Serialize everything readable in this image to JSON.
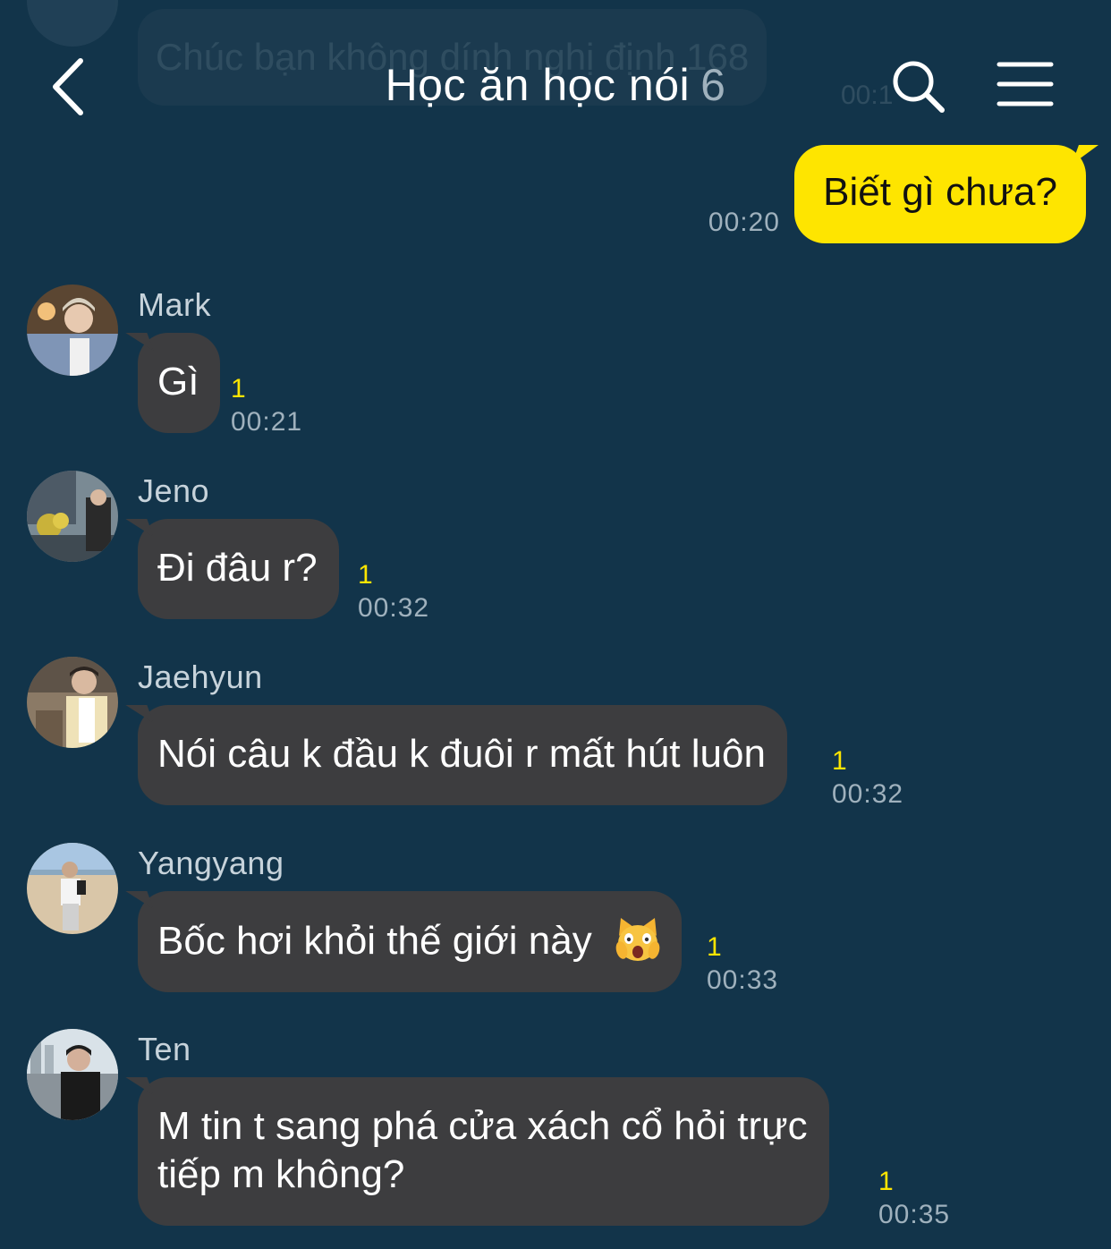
{
  "ghost_message": {
    "text": "Chúc bạn không dính nghị định 168",
    "time": "00:1"
  },
  "header": {
    "title": "Học ăn học nói",
    "member_count": "6"
  },
  "colors": {
    "background": "#12344a",
    "my_bubble": "#fee500",
    "their_bubble": "#3d3d3f",
    "unread": "#fee500"
  },
  "messages": [
    {
      "sender": "",
      "text": "Biết gì chưa?",
      "time": "00:20",
      "outgoing": true
    },
    {
      "sender": "Mark",
      "text": "Gì",
      "unread": "1",
      "time": "00:21"
    },
    {
      "sender": "Jeno",
      "text": "Đi đâu r?",
      "unread": "1",
      "time": "00:32"
    },
    {
      "sender": "Jaehyun",
      "text": "Nói câu k đầu k đuôi r mất hút luôn",
      "unread": "1",
      "time": "00:32"
    },
    {
      "sender": "Yangyang",
      "text": "Bốc hơi khỏi thế giới này",
      "emoji": "weary-cat-face",
      "unread": "1",
      "time": "00:33"
    },
    {
      "sender": "Ten",
      "text_line1": "M tin t sang phá cửa xách cổ hỏi trực",
      "text_line2": "tiếp m không?",
      "unread": "1",
      "time": "00:35"
    }
  ]
}
